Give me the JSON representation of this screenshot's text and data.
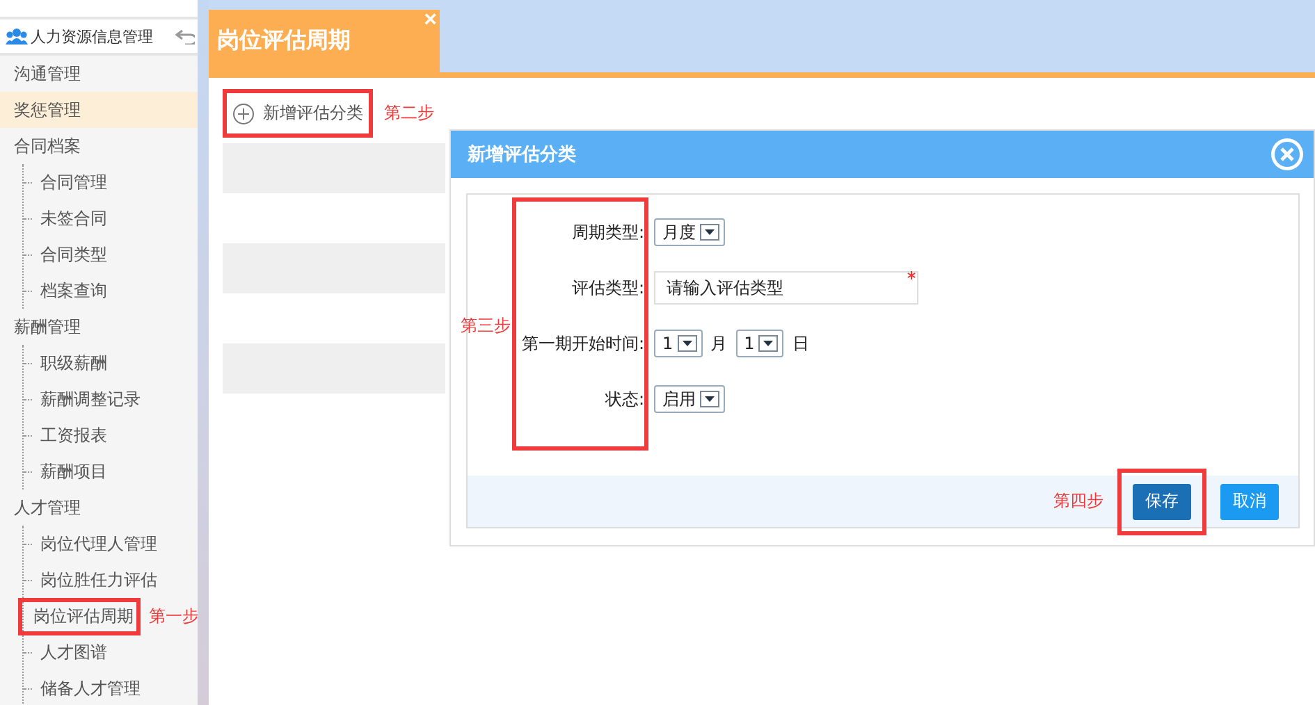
{
  "sidebar": {
    "section": "人力资源信息管理",
    "items": [
      {
        "label": "沟通管理",
        "selected": false
      },
      {
        "label": "奖惩管理",
        "selected": true
      },
      {
        "label": "合同档案",
        "selected": false,
        "children": [
          {
            "label": "合同管理",
            "selected": false
          },
          {
            "label": "未签合同",
            "selected": false
          },
          {
            "label": "合同类型",
            "selected": false
          },
          {
            "label": "档案查询",
            "selected": false
          }
        ]
      },
      {
        "label": "薪酬管理",
        "selected": false,
        "children": [
          {
            "label": "职级薪酬",
            "selected": false
          },
          {
            "label": "薪酬调整记录",
            "selected": false
          },
          {
            "label": "工资报表",
            "selected": false
          },
          {
            "label": "薪酬项目",
            "selected": false
          }
        ]
      },
      {
        "label": "人才管理",
        "selected": false,
        "children": [
          {
            "label": "岗位代理人管理",
            "selected": false
          },
          {
            "label": "岗位胜任力评估",
            "selected": false
          },
          {
            "label": "岗位评估周期",
            "selected": false,
            "annotation": "第一步"
          },
          {
            "label": "人才图谱",
            "selected": false
          },
          {
            "label": "储备人才管理",
            "selected": false
          }
        ]
      }
    ]
  },
  "tab": {
    "title": "岗位评估周期",
    "close": "×"
  },
  "add_button": {
    "label": "新增评估分类",
    "annotation": "第二步"
  },
  "dialog": {
    "title": "新增评估分类",
    "annotation": "第三步",
    "fields": [
      {
        "kind": "select",
        "label": "周期类型:",
        "value": "月度"
      },
      {
        "kind": "text",
        "label": "评估类型:",
        "value": "请输入评估类型",
        "required": true
      },
      {
        "kind": "date",
        "label": "第一期开始时间:",
        "month": "1",
        "month_unit": "月",
        "day": "1",
        "day_unit": "日"
      },
      {
        "kind": "select",
        "label": "状态:",
        "value": "启用"
      }
    ],
    "buttons": [
      {
        "label": "保存",
        "kind": "primary",
        "annotation": "第四步"
      },
      {
        "label": "取消",
        "kind": "secondary"
      }
    ]
  }
}
